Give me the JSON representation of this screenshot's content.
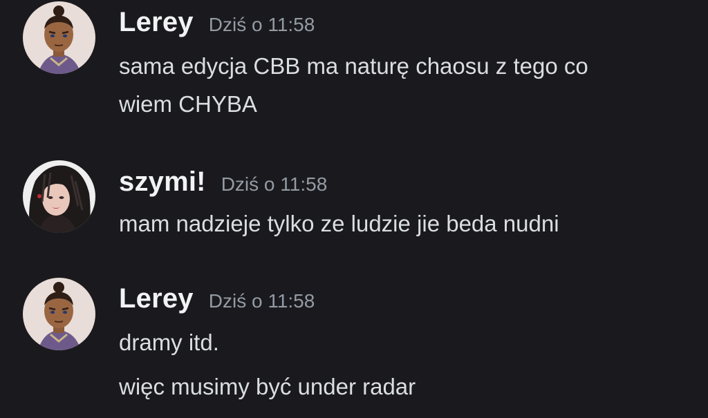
{
  "messages": [
    {
      "author": "Lerey",
      "timestamp": "Dziś o 11:58",
      "avatar_icon": "sokka-avatar-icon",
      "lines": [
        "sama edycja CBB ma naturę chaosu z tego co",
        "wiem CHYBA"
      ]
    },
    {
      "author": "szymi!",
      "timestamp": "Dziś o 11:58",
      "avatar_icon": "girl-portrait-avatar-icon",
      "lines": [
        "mam nadzieje tylko ze ludzie jie beda nudni"
      ]
    },
    {
      "author": "Lerey",
      "timestamp": "Dziś o 11:58",
      "avatar_icon": "sokka-avatar-icon",
      "lines": [
        "dramy itd.",
        "więc musimy być under radar"
      ]
    }
  ],
  "colors": {
    "background": "#1a1a1e",
    "username": "#f2f3f5",
    "timestamp": "#949ba4",
    "message_text": "#dbdee1"
  }
}
